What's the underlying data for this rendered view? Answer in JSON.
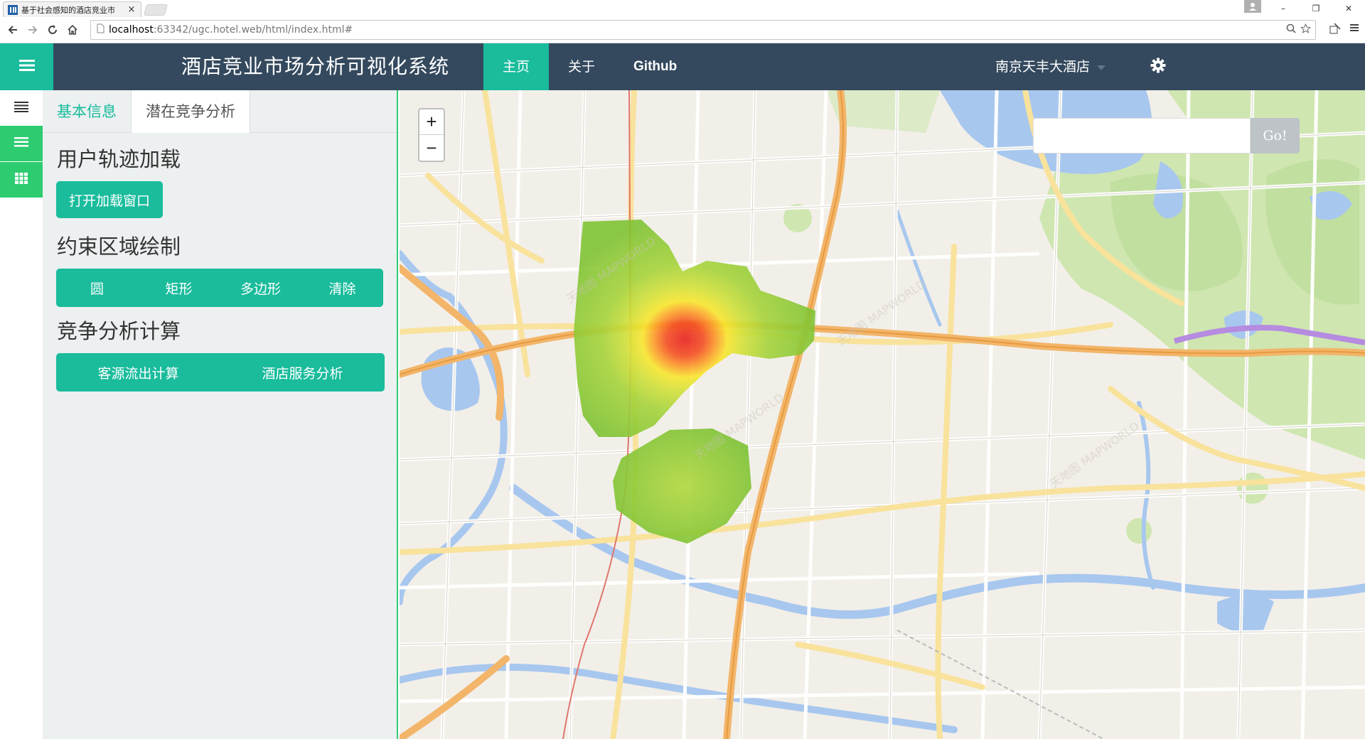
{
  "browser": {
    "tab_title": "基于社会感知的酒店竞业市",
    "tab_close": "×",
    "url_host": "localhost",
    "url_rest": ":63342/ugc.hotel.web/html/index.html#",
    "window_controls": [
      "–",
      "❐",
      "✕"
    ]
  },
  "header": {
    "title": "酒店竞业市场分析可视化系统",
    "nav": [
      "主页",
      "关于",
      "Github"
    ],
    "hotel": "南京天丰大酒店"
  },
  "panel": {
    "tabs": [
      "基本信息",
      "潜在竞争分析"
    ],
    "section1_title": "用户轨迹加载",
    "open_button": "打开加载窗口",
    "section2_title": "约束区域绘制",
    "draw_buttons": [
      "圆",
      "矩形",
      "多边形",
      "清除"
    ],
    "section3_title": "竞争分析计算",
    "calc_buttons": [
      "客源流出计算",
      "酒店服务分析"
    ]
  },
  "map": {
    "zoom_in": "+",
    "zoom_out": "−",
    "search_placeholder": "",
    "go_label": "Go!"
  },
  "colors": {
    "header_bg": "#34495e",
    "accent": "#1abc9c",
    "rail_green": "#2ecc71",
    "panel_bg": "#ecf0f1"
  }
}
